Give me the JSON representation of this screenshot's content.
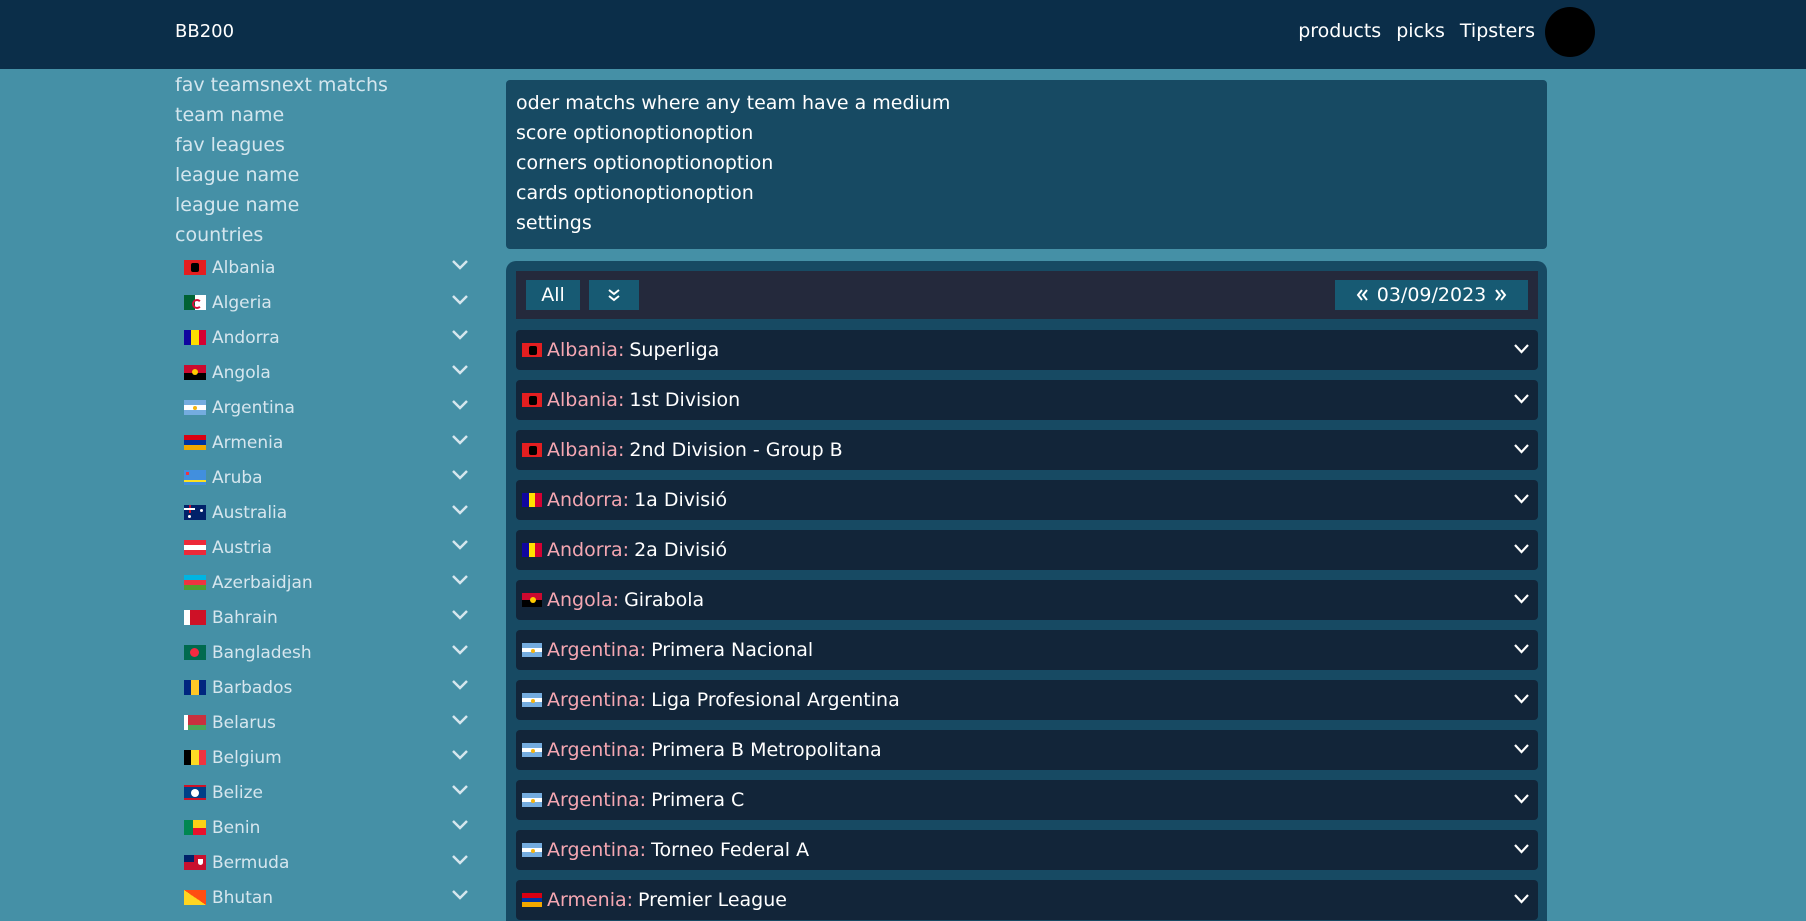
{
  "app": {
    "brand": "BB200"
  },
  "nav": {
    "products": "products",
    "picks": "picks",
    "tipsters": "Tipsters"
  },
  "sidebar": {
    "links": [
      "fav teamsnext matchs",
      "team name",
      "fav leagues",
      "league name",
      "league name",
      "countries"
    ],
    "countries": [
      {
        "name": "Albania",
        "flag": "albania-flag"
      },
      {
        "name": "Algeria",
        "flag": "algeria-flag"
      },
      {
        "name": "Andorra",
        "flag": "andorra-flag"
      },
      {
        "name": "Angola",
        "flag": "angola-flag"
      },
      {
        "name": "Argentina",
        "flag": "argentina-flag"
      },
      {
        "name": "Armenia",
        "flag": "armenia-flag"
      },
      {
        "name": "Aruba",
        "flag": "aruba-flag"
      },
      {
        "name": "Australia",
        "flag": "australia-flag"
      },
      {
        "name": "Austria",
        "flag": "austria-flag"
      },
      {
        "name": "Azerbaidjan",
        "flag": "azerbaijan-flag"
      },
      {
        "name": "Bahrain",
        "flag": "bahrain-flag"
      },
      {
        "name": "Bangladesh",
        "flag": "bangladesh-flag"
      },
      {
        "name": "Barbados",
        "flag": "barbados-flag"
      },
      {
        "name": "Belarus",
        "flag": "belarus-flag"
      },
      {
        "name": "Belgium",
        "flag": "belgium-flag"
      },
      {
        "name": "Belize",
        "flag": "belize-flag"
      },
      {
        "name": "Benin",
        "flag": "benin-flag"
      },
      {
        "name": "Bermuda",
        "flag": "bermuda-flag"
      },
      {
        "name": "Bhutan",
        "flag": "bhutan-flag"
      }
    ]
  },
  "filters": {
    "line1": "oder matchs where any team have a medium",
    "line2": "score optionoptionoption",
    "line3": "corners optionoptionoption",
    "line4": "cards optionoptionoption",
    "line5": "settings"
  },
  "toolbar": {
    "all_label": "All",
    "date": "03/09/2023"
  },
  "leagues": [
    {
      "country": "Albania:",
      "name": "Superliga",
      "flag": "albania-flag"
    },
    {
      "country": "Albania:",
      "name": "1st Division",
      "flag": "albania-flag"
    },
    {
      "country": "Albania:",
      "name": "2nd Division - Group B",
      "flag": "albania-flag"
    },
    {
      "country": "Andorra:",
      "name": "1a Divisió",
      "flag": "andorra-flag"
    },
    {
      "country": "Andorra:",
      "name": "2a Divisió",
      "flag": "andorra-flag"
    },
    {
      "country": "Angola:",
      "name": "Girabola",
      "flag": "angola-flag"
    },
    {
      "country": "Argentina:",
      "name": "Primera Nacional",
      "flag": "argentina-flag"
    },
    {
      "country": "Argentina:",
      "name": "Liga Profesional Argentina",
      "flag": "argentina-flag"
    },
    {
      "country": "Argentina:",
      "name": "Primera B Metropolitana",
      "flag": "argentina-flag"
    },
    {
      "country": "Argentina:",
      "name": "Primera C",
      "flag": "argentina-flag"
    },
    {
      "country": "Argentina:",
      "name": "Torneo Federal A",
      "flag": "argentina-flag"
    },
    {
      "country": "Armenia:",
      "name": "Premier League",
      "flag": "armenia-flag"
    }
  ],
  "colors": {
    "topbar": "#0b2e49",
    "page": "#4590a6",
    "panel": "#174a63",
    "league_row": "#122539",
    "country_text": "#f5a7b2",
    "button": "#175a73"
  }
}
